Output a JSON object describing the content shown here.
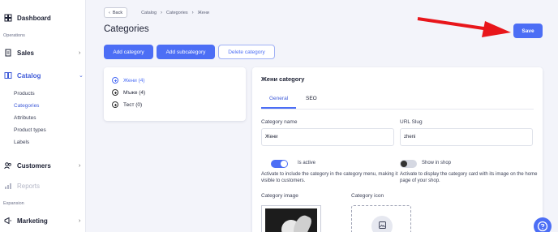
{
  "sidebar": {
    "dashboard": "Dashboard",
    "operations_label": "Operations",
    "sales": "Sales",
    "catalog": "Catalog",
    "catalog_items": [
      "Products",
      "Categories",
      "Attributes",
      "Product types",
      "Labels"
    ],
    "customers": "Customers",
    "reports": "Reports",
    "expansion_label": "Expansion",
    "marketing": "Marketing"
  },
  "breadcrumb": {
    "back": "Back",
    "items": [
      "Catalog",
      "Categories",
      "Жени"
    ]
  },
  "page": {
    "title": "Categories",
    "save": "Save"
  },
  "actions": {
    "add_category": "Add category",
    "add_subcategory": "Add subcategory",
    "delete_category": "Delete category"
  },
  "tree": {
    "items": [
      "Жени (4)",
      "Мъже (4)",
      "Тест (0)"
    ],
    "selected_index": 0
  },
  "detail": {
    "title": "Жени category",
    "tabs": [
      "General",
      "SEO"
    ],
    "category_name_label": "Category name",
    "category_name_value": "Жени",
    "url_slug_label": "URL Slug",
    "url_slug_value": "zheni",
    "is_active_label": "Is active",
    "is_active_on": true,
    "is_active_help": "Activate to include the category in the category menu, making it visible to customers.",
    "show_in_shop_label": "Show in shop",
    "show_in_shop_on": false,
    "show_in_shop_help": "Activate to display the category card with its image on the home page of your shop.",
    "category_image_label": "Category image",
    "category_icon_label": "Category icon"
  },
  "colors": {
    "accent": "#4c6ef5",
    "annotation_arrow": "#e8161b"
  }
}
